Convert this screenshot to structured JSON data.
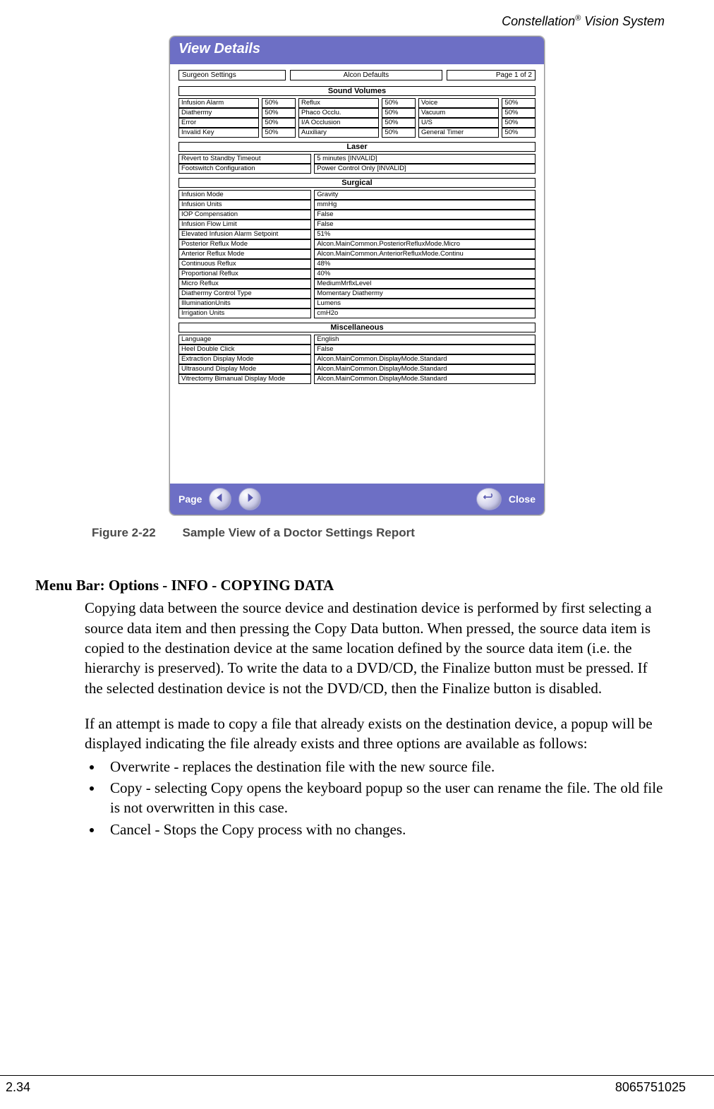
{
  "header": {
    "product_prefix": "Constellation",
    "product_suffix": " Vision System",
    "trademark": "®"
  },
  "dialog": {
    "title": "View Details",
    "topbar": [
      "Surgeon Settings",
      "Alcon Defaults",
      "Page 1 of 2"
    ],
    "sections": {
      "sound": {
        "title": "Sound Volumes",
        "rows": [
          [
            "Infusion Alarm",
            "50%",
            "Reflux",
            "50%",
            "Voice",
            "50%"
          ],
          [
            "Diathermy",
            "50%",
            "Phaco Occlu.",
            "50%",
            "Vacuum",
            "50%"
          ],
          [
            "Error",
            "50%",
            "I/A Occlusion",
            "50%",
            "U/S",
            "50%"
          ],
          [
            "Invalid Key",
            "50%",
            "Auxiliary",
            "50%",
            "General Timer",
            "50%"
          ]
        ]
      },
      "laser": {
        "title": "Laser",
        "rows": [
          [
            "Revert to Standby Timeout",
            "5 minutes  [INVALID]"
          ],
          [
            "Footswitch Configuration",
            "Power Control Only [INVALID]"
          ]
        ]
      },
      "surgical": {
        "title": "Surgical",
        "rows": [
          [
            "Infusion Mode",
            "Gravity"
          ],
          [
            "Infusion Units",
            "mmHg"
          ],
          [
            "IOP Compensation",
            "False"
          ],
          [
            "Infusion Flow Limit",
            "False"
          ],
          [
            "Elevated Infusion Alarm Setpoint",
            "51%"
          ],
          [
            "Posterior Reflux Mode",
            "Alcon.MainCommon.PosteriorRefluxMode.Micro"
          ],
          [
            "Anterior Reflux Mode",
            "Alcon.MainCommon.AnteriorRefluxMode.Continu"
          ],
          [
            "Continuous Reflux",
            "48%"
          ],
          [
            "Proportional Reflux",
            "40%"
          ],
          [
            "Micro Reflux",
            "MediumMrflxLevel"
          ],
          [
            "Diathermy Control Type",
            "Momentary Diathermy"
          ],
          [
            "IlluminationUnits",
            "Lumens"
          ],
          [
            "Irrigation Units",
            "cmH2o"
          ]
        ]
      },
      "misc": {
        "title": "Miscellaneous",
        "rows": [
          [
            "Language",
            "English"
          ],
          [
            "Heel Double Click",
            "False"
          ],
          [
            "Extraction Display Mode",
            "Alcon.MainCommon.DisplayMode.Standard"
          ],
          [
            "Ultrasound Display Mode",
            "Alcon.MainCommon.DisplayMode.Standard"
          ],
          [
            "Vitrectomy Bimanual Display Mode",
            "Alcon.MainCommon.DisplayMode.Standard"
          ]
        ]
      }
    },
    "footer": {
      "page_label": "Page",
      "close_label": "Close"
    }
  },
  "caption": {
    "figure": "Figure 2-22",
    "text": "Sample View of a Doctor Settings Report"
  },
  "content": {
    "heading": "Menu Bar: Options - INFO - COPYING DATA",
    "para1": "Copying data between the source device and destination device is performed by first selecting a source data item and then pressing the Copy Data button. When pressed, the source data item is copied to the destination device at the same location defined by the source data item (i.e. the hierarchy is preserved).  To write the data to a DVD/CD, the Finalize button must be pressed.  If the selected destination device is not the DVD/CD, then the Finalize button is disabled.",
    "para2": "If an attempt is made to copy a file that already exists on the destination device, a popup will be displayed indicating the file already exists and three options are available as follows:",
    "bullets": [
      "Overwrite - replaces the destination file with the new source file.",
      "Copy - selecting Copy opens the keyboard popup so the user can rename the file. The old file is not overwritten in this case.",
      "Cancel - Stops the Copy process with no changes."
    ]
  },
  "footer": {
    "page_num": "2.34",
    "doc_num": "8065751025"
  }
}
